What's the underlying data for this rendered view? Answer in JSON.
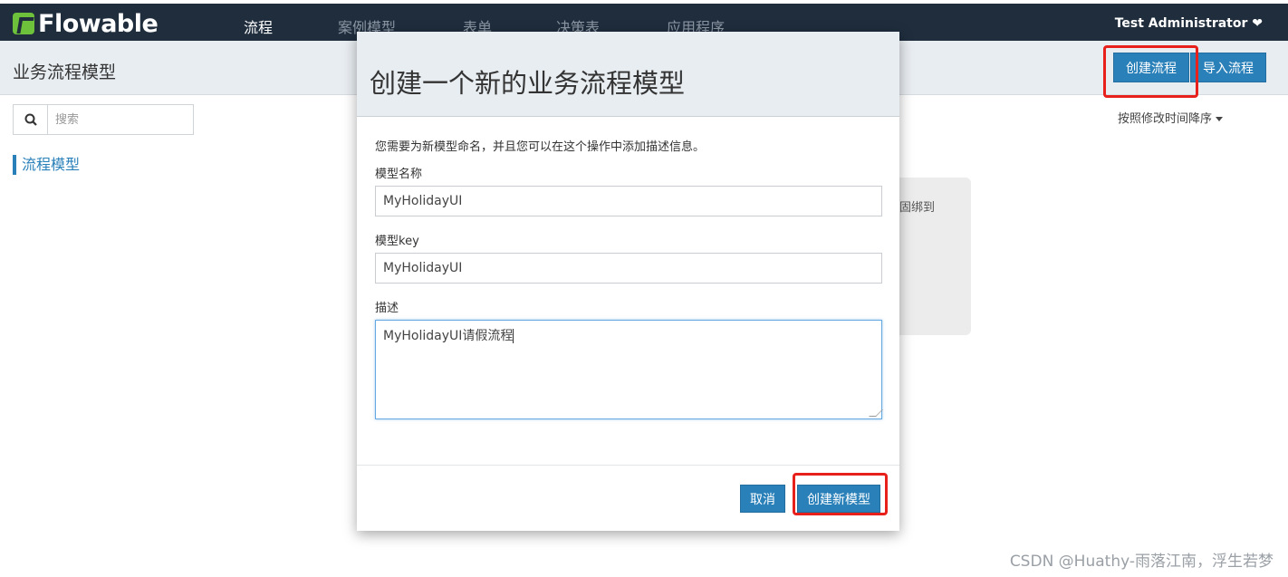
{
  "navbar": {
    "brand": "Flowable",
    "items": [
      {
        "label": "流程",
        "active": true
      },
      {
        "label": "案例模型",
        "active": false
      },
      {
        "label": "表单",
        "active": false
      },
      {
        "label": "决策表",
        "active": false
      },
      {
        "label": "应用程序",
        "active": false
      }
    ],
    "user": "Test Administrator ❤"
  },
  "subheader": {
    "title": "业务流程模型",
    "create_button": "创建流程",
    "import_button": "导入流程"
  },
  "sidebar": {
    "search_placeholder": "搜索",
    "nav_item": "流程模型"
  },
  "main": {
    "sort_label": "按照修改时间降序",
    "card_text_fragment": "固绑到"
  },
  "modal": {
    "title": "创建一个新的业务流程模型",
    "description": "您需要为新模型命名，并且您可以在这个操作中添加描述信息。",
    "fields": {
      "name_label": "模型名称",
      "name_value": "MyHolidayUI",
      "key_label": "模型key",
      "key_value": "MyHolidayUI",
      "desc_label": "描述",
      "desc_value": "MyHolidayUI请假流程"
    },
    "cancel_button": "取消",
    "submit_button": "创建新模型"
  },
  "watermark": "CSDN @Huathy-雨落江南，浮生若梦",
  "colors": {
    "navbar_bg": "#1f2d3d",
    "primary": "#2a80b9",
    "highlight_box": "#e8201c",
    "brand_green": "#6ec23b"
  }
}
